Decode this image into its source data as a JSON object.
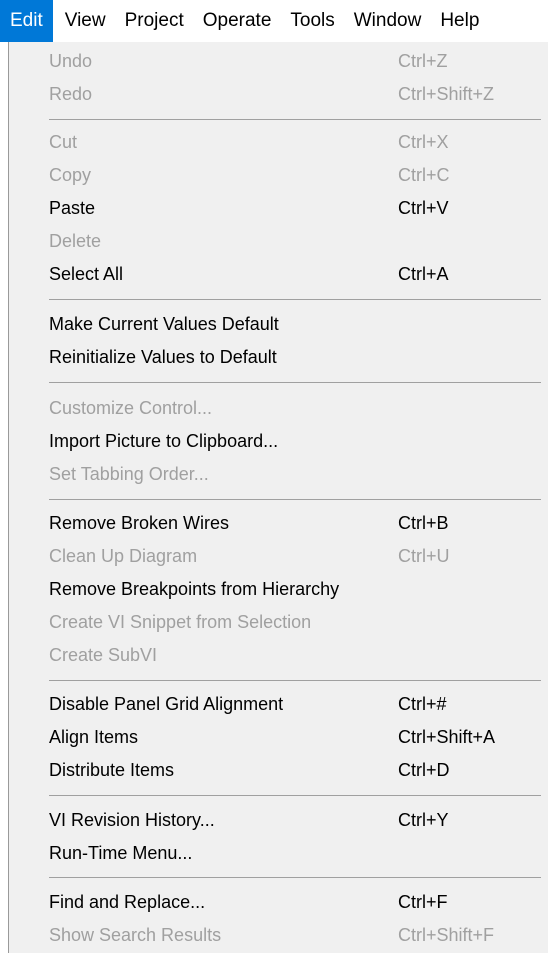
{
  "menubar": {
    "items": [
      {
        "label": "Edit"
      },
      {
        "label": "View"
      },
      {
        "label": "Project"
      },
      {
        "label": "Operate"
      },
      {
        "label": "Tools"
      },
      {
        "label": "Window"
      },
      {
        "label": "Help"
      }
    ]
  },
  "edit_menu": {
    "items": [
      {
        "label": "Undo",
        "shortcut": "Ctrl+Z",
        "enabled": false
      },
      {
        "label": "Redo",
        "shortcut": "Ctrl+Shift+Z",
        "enabled": false
      },
      {
        "label": "Cut",
        "shortcut": "Ctrl+X",
        "enabled": false
      },
      {
        "label": "Copy",
        "shortcut": "Ctrl+C",
        "enabled": false
      },
      {
        "label": "Paste",
        "shortcut": "Ctrl+V",
        "enabled": true
      },
      {
        "label": "Delete",
        "shortcut": "",
        "enabled": false
      },
      {
        "label": "Select All",
        "shortcut": "Ctrl+A",
        "enabled": true
      },
      {
        "label": "Make Current Values Default",
        "shortcut": "",
        "enabled": true
      },
      {
        "label": "Reinitialize Values to Default",
        "shortcut": "",
        "enabled": true
      },
      {
        "label": "Customize Control...",
        "shortcut": "",
        "enabled": false
      },
      {
        "label": "Import Picture to Clipboard...",
        "shortcut": "",
        "enabled": true
      },
      {
        "label": "Set Tabbing Order...",
        "shortcut": "",
        "enabled": false
      },
      {
        "label": "Remove Broken Wires",
        "shortcut": "Ctrl+B",
        "enabled": true
      },
      {
        "label": "Clean Up Diagram",
        "shortcut": "Ctrl+U",
        "enabled": false
      },
      {
        "label": "Remove Breakpoints from Hierarchy",
        "shortcut": "",
        "enabled": true
      },
      {
        "label": "Create VI Snippet from Selection",
        "shortcut": "",
        "enabled": false
      },
      {
        "label": "Create SubVI",
        "shortcut": "",
        "enabled": false
      },
      {
        "label": "Disable Panel Grid Alignment",
        "shortcut": "Ctrl+#",
        "enabled": true
      },
      {
        "label": "Align Items",
        "shortcut": "Ctrl+Shift+A",
        "enabled": true
      },
      {
        "label": "Distribute Items",
        "shortcut": "Ctrl+D",
        "enabled": true
      },
      {
        "label": "VI Revision History...",
        "shortcut": "Ctrl+Y",
        "enabled": true
      },
      {
        "label": "Run-Time Menu...",
        "shortcut": "",
        "enabled": true
      },
      {
        "label": "Find and Replace...",
        "shortcut": "Ctrl+F",
        "enabled": true
      },
      {
        "label": "Show Search Results",
        "shortcut": "Ctrl+Shift+F",
        "enabled": false
      }
    ]
  },
  "colors": {
    "menubar_highlight": "#0078d7",
    "menu_background": "#f0f0f0",
    "enabled_text": "#000000",
    "disabled_text": "#a0a0a0"
  }
}
